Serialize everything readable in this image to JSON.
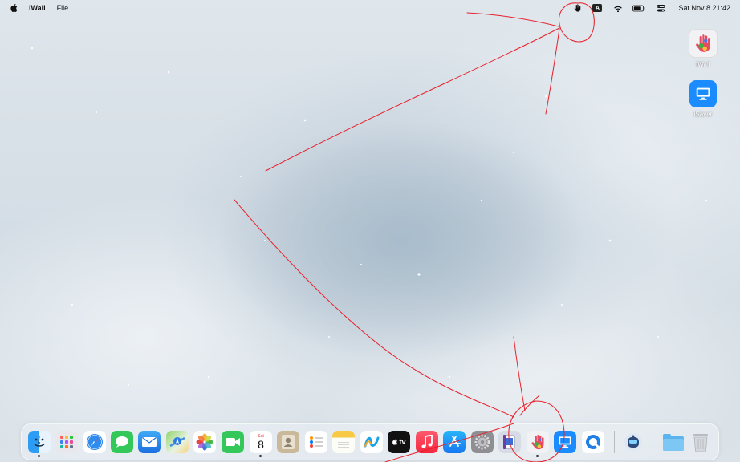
{
  "menubar": {
    "app_name": "iWall",
    "menu_file": "File",
    "clock": "Sat Nov 8  21:42",
    "input_source": "A",
    "status_icons": [
      "iwall-hand-icon",
      "keyboard-input-icon",
      "wifi-icon",
      "battery-icon",
      "control-center-icon"
    ]
  },
  "desktop": {
    "icons": [
      {
        "label": "iWall",
        "icon": "iwall-app-icon"
      },
      {
        "label": "iSaver",
        "icon": "isaver-app-icon"
      }
    ]
  },
  "dock": {
    "calendar_day": "Sat",
    "calendar_date": "8",
    "tv_label": "tv",
    "apps": [
      "Finder",
      "Launchpad",
      "Safari",
      "Messages",
      "Mail",
      "Maps",
      "Photos",
      "FaceTime",
      "Calendar",
      "Contacts",
      "Reminders",
      "Notes",
      "Freeform",
      "TV",
      "Music",
      "App Store",
      "System Settings",
      "Preview",
      "iWall",
      "iSaver",
      "QuickTime Player",
      "Screensaver",
      "Downloads",
      "Trash"
    ],
    "running": [
      "Finder",
      "Calendar",
      "iWall"
    ]
  },
  "colors": {
    "annotation": "#e8202a",
    "accent_blue": "#1a8cff"
  }
}
